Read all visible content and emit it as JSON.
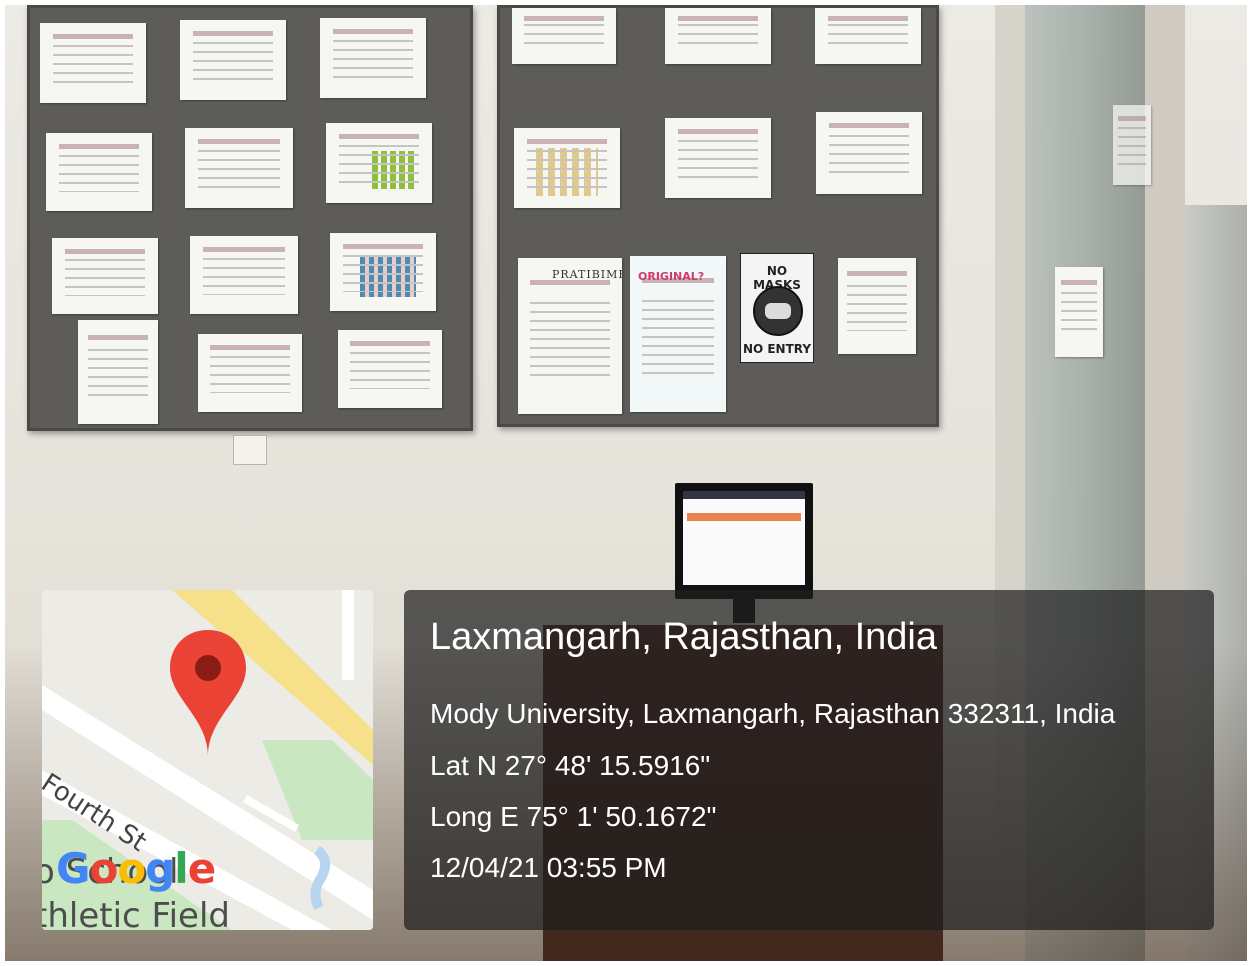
{
  "location": {
    "title": "Laxmangarh, Rajasthan, India",
    "address": "Mody University, Laxmangarh, Rajasthan 332311, India",
    "latitude": "Lat N 27° 48' 15.5916\"",
    "longitude": "Long E 75° 1' 50.1672\"",
    "datetime": "12/04/21 03:55 PM"
  },
  "map": {
    "street_label": "Fourth St",
    "field_label_top": "o School",
    "field_label_bottom": "thletic Field",
    "watermark": [
      "G",
      "o",
      "o",
      "g",
      "l",
      "e"
    ],
    "watermark_colors": [
      "#4285F4",
      "#EA4335",
      "#FBBC05",
      "#4285F4",
      "#34A853",
      "#EA4335"
    ],
    "pin_color": "#EA4335",
    "pin_dot_color": "#8a1c14"
  },
  "scene": {
    "sign_top": "NO MASKS",
    "sign_bottom": "NO ENTRY",
    "newsletter_title": "PRATIBIMB",
    "poster_title": "ORIGINAL?"
  }
}
